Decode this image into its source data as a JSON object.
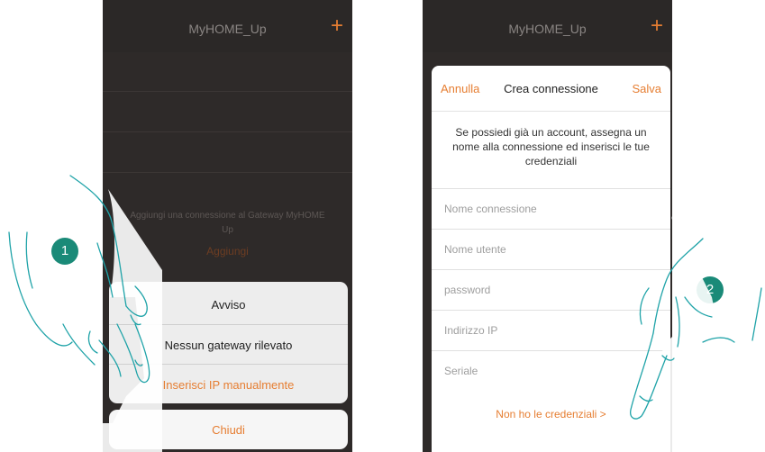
{
  "left_screen": {
    "app_title": "MyHOME_Up",
    "plus_icon": "+",
    "hint_text": "Aggiungi una connessione al Gateway MyHOME Up",
    "add_link": "Aggiungi",
    "alert": {
      "title": "Avviso",
      "message": "Nessun gateway rilevato",
      "action": "Inserisci IP manualmente",
      "close": "Chiudi"
    },
    "step_badge": "1"
  },
  "right_screen": {
    "app_title": "MyHOME_Up",
    "plus_icon": "+",
    "header": {
      "cancel": "Annulla",
      "title": "Crea connessione",
      "save": "Salva"
    },
    "intro": "Se possiedi già un account, assegna un nome alla connessione ed inserisci le tue credenziali",
    "fields": {
      "connection_name": {
        "placeholder": "Nome connessione",
        "value": ""
      },
      "username": {
        "placeholder": "Nome utente",
        "value": ""
      },
      "password": {
        "placeholder": "password",
        "value": ""
      },
      "ip_address": {
        "placeholder": "Indirizzo IP",
        "value": ""
      },
      "serial": {
        "placeholder": "Seriale",
        "value": ""
      }
    },
    "no_credentials_link": "Non ho le credenziali >",
    "step_badge": "2"
  },
  "colors": {
    "accent_orange": "#e67e32",
    "badge_teal": "#1a8a78",
    "dark_background": "#2e2a29",
    "hand_outline": "#1fa3a8"
  },
  "icons": [
    "plus-icon",
    "pointing-hand-icon"
  ]
}
